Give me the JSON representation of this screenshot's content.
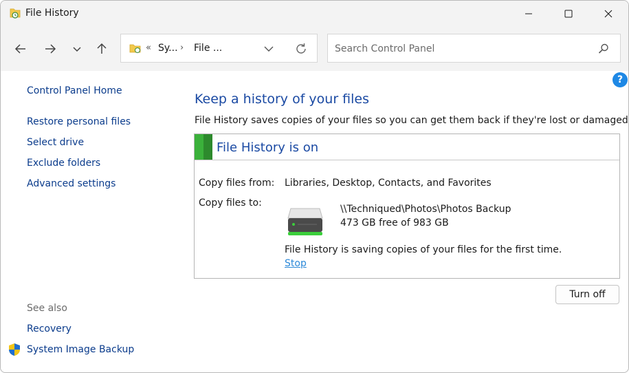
{
  "window": {
    "title": "File History"
  },
  "titlebar": {
    "minimize_icon": "minimize-icon",
    "maximize_icon": "maximize-icon",
    "close_icon": "close-icon"
  },
  "nav": {
    "breadcrumb_prefix": "«",
    "breadcrumb": [
      "Sy...",
      "File ..."
    ],
    "breadcrumb_separator": "›"
  },
  "search": {
    "placeholder": "Search Control Panel",
    "value": ""
  },
  "sidebar": {
    "home": "Control Panel Home",
    "links": [
      "Restore personal files",
      "Select drive",
      "Exclude folders",
      "Advanced settings"
    ],
    "see_also_label": "See also",
    "see_also_links": [
      "Recovery",
      "System Image Backup"
    ]
  },
  "main": {
    "heading": "Keep a history of your files",
    "description": "File History saves copies of your files so you can get them back if they're lost or damaged.",
    "status_title": "File History is on",
    "copy_from_label": "Copy files from:",
    "copy_from_value": "Libraries, Desktop, Contacts, and Favorites",
    "copy_to_label": "Copy files to:",
    "drive_path": "\\\\Techniqued\\Photos\\Photos Backup",
    "drive_space": "473 GB free of 983 GB",
    "saving_message": "File History is saving copies of your files for the first time.",
    "stop_link": "Stop",
    "turn_off_button": "Turn off"
  },
  "colors": {
    "link": "#0b3c8c",
    "heading": "#1b4aa3",
    "status_green": "#3bb13b",
    "stop_link": "#2b88d8",
    "chrome_bg": "#f3f3f3"
  },
  "help": {
    "label": "?"
  }
}
